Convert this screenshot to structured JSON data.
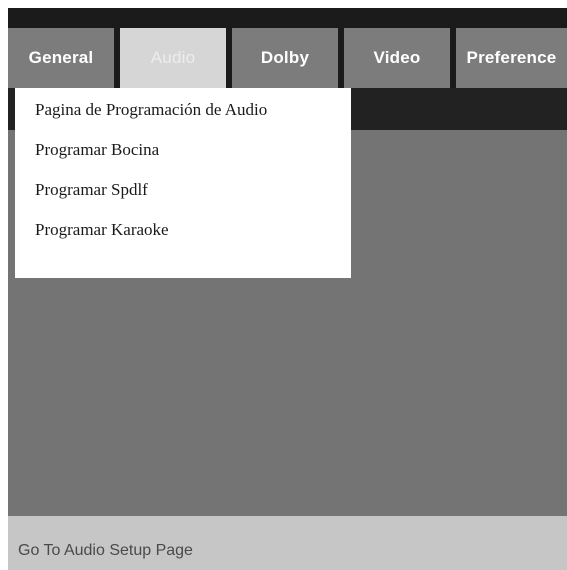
{
  "tabs": [
    {
      "label": "General"
    },
    {
      "label": "Audio"
    },
    {
      "label": "Dolby"
    },
    {
      "label": "Video"
    },
    {
      "label": "Preference"
    }
  ],
  "active_tab": "Audio",
  "menu": {
    "items": [
      {
        "label": "Pagina de Programación de Audio"
      },
      {
        "label": "Programar Bocina"
      },
      {
        "label": "Programar Spdlf"
      },
      {
        "label": "Programar Karaoke"
      }
    ]
  },
  "status": {
    "text": "Go To Audio Setup Page"
  }
}
